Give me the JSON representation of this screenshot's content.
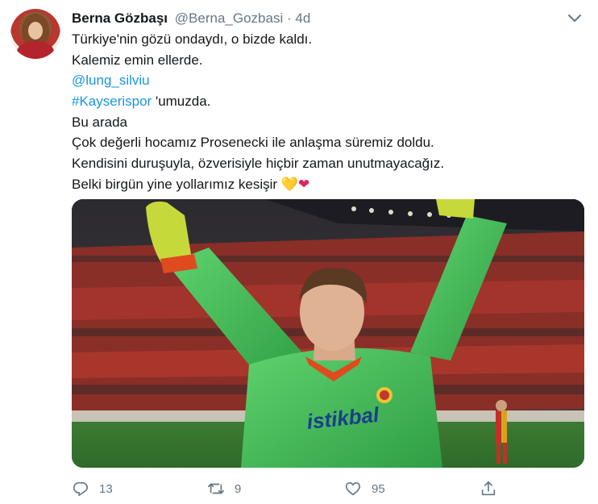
{
  "tweet": {
    "display_name": "Berna Gözbaşı",
    "handle": "@Berna_Gozbasi",
    "separator": "·",
    "time": "4d",
    "lines": [
      {
        "text": "Türkiye'nin gözü ondaydı, o bizde kaldı."
      },
      {
        "text": "Kalemiz emin ellerde."
      },
      {
        "text": "@lung_silviu"
      },
      {
        "hashtag": "#Kayserispor",
        "rest": " 'umuzda."
      },
      {
        "text": "Bu arada"
      },
      {
        "text": "Çok değerli hocamız Prosenecki ile anlaşma süremiz doldu."
      },
      {
        "text": "Kendisini duruşuyla, özverisiyle hiçbir zaman unutmayacağız."
      },
      {
        "text": "Belki birgün yine yollarımız kesişir ",
        "emoji_1": "💛",
        "emoji_2": "❤"
      }
    ],
    "media": {
      "jersey_text": "istikbal"
    },
    "actions": {
      "reply_count": "13",
      "retweet_count": "9",
      "like_count": "95"
    }
  },
  "colors": {
    "link": "#1b95e0",
    "muted": "#657786",
    "text": "#14171a"
  }
}
